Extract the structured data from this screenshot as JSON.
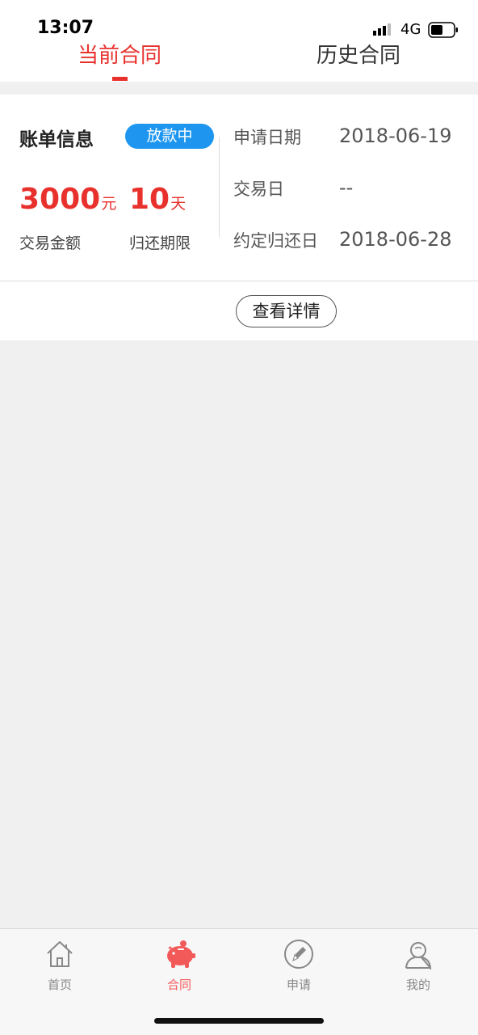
{
  "status_bar": {
    "time": "13:07",
    "network": "4G",
    "icons": [
      "signal-icon",
      "battery-icon"
    ]
  },
  "tabs": [
    {
      "label": "当前合同",
      "active": true
    },
    {
      "label": "历史合同",
      "active": false
    }
  ],
  "bill": {
    "title": "账单信息",
    "status": "放款中",
    "amount": "3000",
    "amount_unit": "元",
    "term": "10",
    "term_unit": "天",
    "amount_label": "交易金额",
    "term_label": "归还期限",
    "rows": [
      {
        "label": "申请日期",
        "value": "2018-06-19"
      },
      {
        "label": "交易日",
        "value": "--"
      },
      {
        "label": "约定归还日",
        "value": "2018-06-28"
      }
    ],
    "detail_button": "查看详情"
  },
  "nav": [
    {
      "label": "首页",
      "icon": "home-icon",
      "active": false
    },
    {
      "label": "合同",
      "icon": "piggy-bank-icon",
      "active": true
    },
    {
      "label": "申请",
      "icon": "pencil-icon",
      "active": false
    },
    {
      "label": "我的",
      "icon": "user-icon",
      "active": false
    }
  ],
  "colors": {
    "accent": "#e8312c",
    "badge": "#1e96f0",
    "background": "#f0f0f0"
  }
}
